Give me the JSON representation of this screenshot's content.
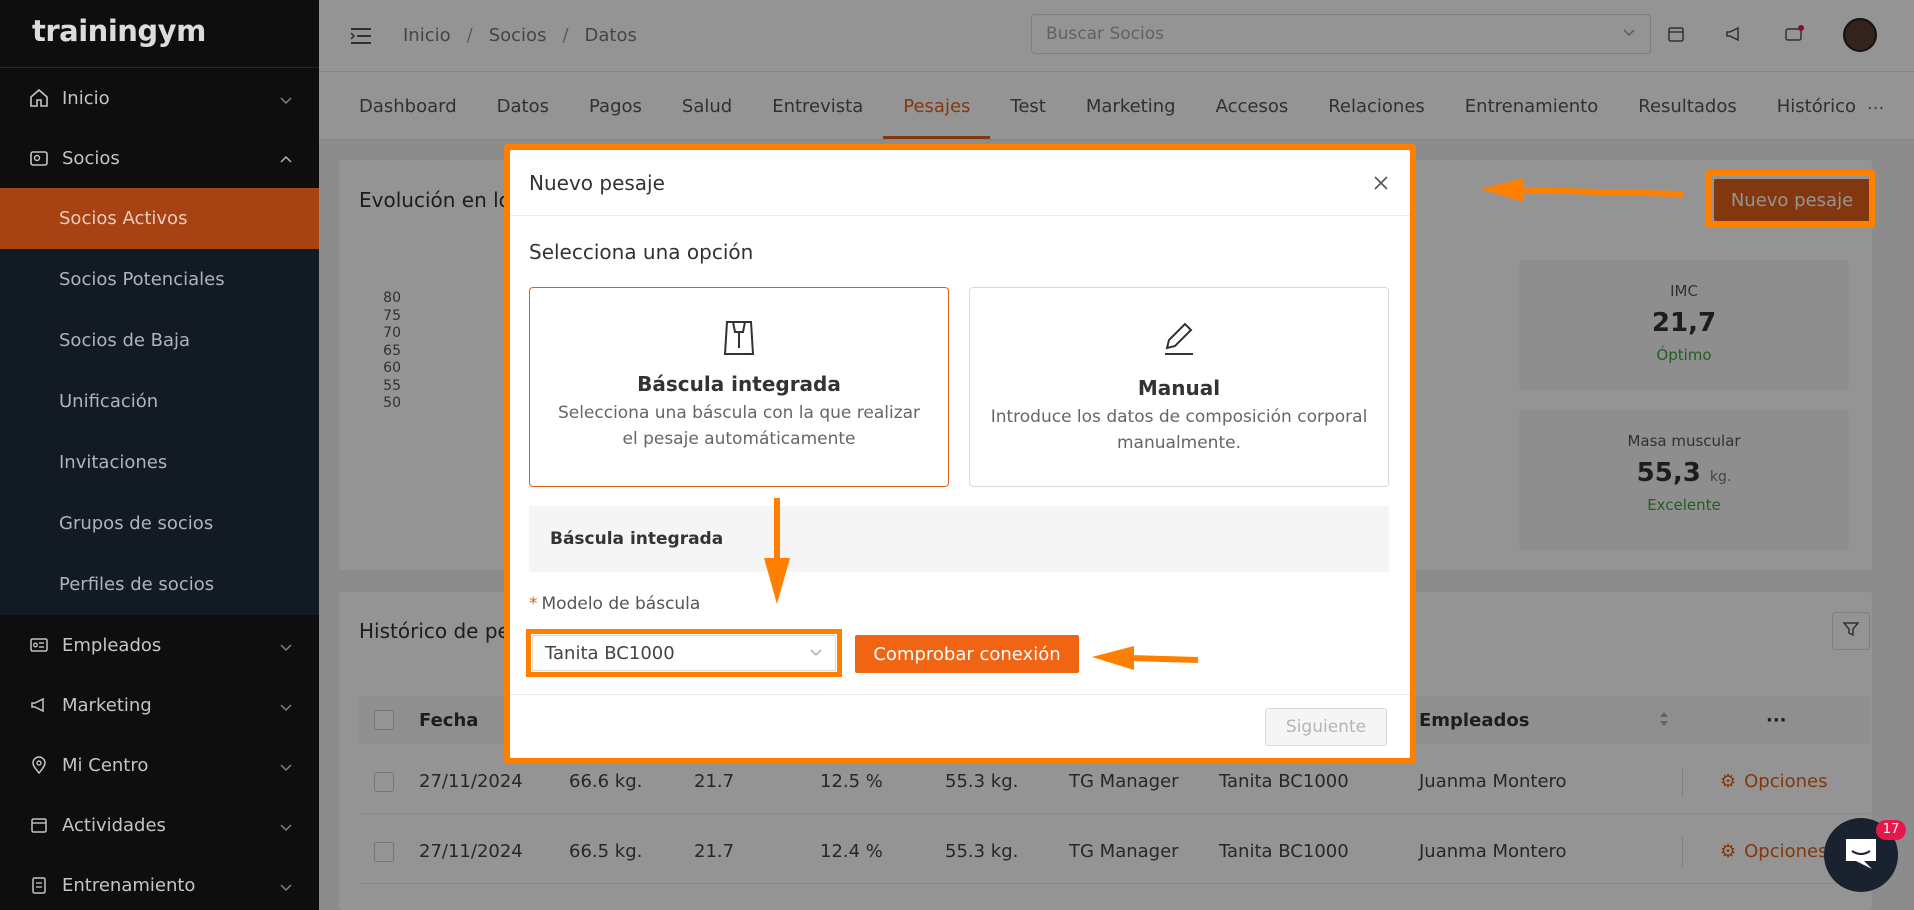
{
  "app": {
    "logo": "trainingym"
  },
  "sidebar": {
    "items": [
      {
        "label": "Inicio",
        "icon": "home-icon"
      },
      {
        "label": "Socios",
        "icon": "members-icon"
      },
      {
        "label": "Empleados",
        "icon": "id-card-icon"
      },
      {
        "label": "Marketing",
        "icon": "megaphone-icon"
      },
      {
        "label": "Mi Centro",
        "icon": "location-icon"
      },
      {
        "label": "Actividades",
        "icon": "calendar-icon"
      },
      {
        "label": "Entrenamiento",
        "icon": "clipboard-icon"
      }
    ],
    "socios_sub": [
      {
        "label": "Socios Activos",
        "active": true
      },
      {
        "label": "Socios Potenciales"
      },
      {
        "label": "Socios de Baja"
      },
      {
        "label": "Unificación"
      },
      {
        "label": "Invitaciones"
      },
      {
        "label": "Grupos de socios"
      },
      {
        "label": "Perfiles de socios"
      }
    ]
  },
  "header": {
    "breadcrumb": [
      "Inicio",
      "Socios",
      "Datos"
    ],
    "search_placeholder": "Buscar Socios"
  },
  "tabs": [
    "Dashboard",
    "Datos",
    "Pagos",
    "Salud",
    "Entrevista",
    "Pesajes",
    "Test",
    "Marketing",
    "Accesos",
    "Relaciones",
    "Entrenamiento",
    "Resultados",
    "Histórico"
  ],
  "tabs_more": "···",
  "active_tab": "Pesajes",
  "evolution": {
    "title": "Evolución en lo",
    "yticks": [
      "80",
      "75",
      "70",
      "65",
      "60",
      "55",
      "50"
    ],
    "new_button": "Nuevo pesaje"
  },
  "stats": [
    {
      "title": "IMC",
      "value": "21,7",
      "unit": "",
      "status": "Óptimo"
    },
    {
      "title": "Masa muscular",
      "value": "55,3",
      "unit": "kg.",
      "status": "Excelente"
    }
  ],
  "history": {
    "title": "Histórico de pe",
    "columns": {
      "fecha": "Fecha",
      "empleados": "Empleados",
      "more": "···"
    },
    "rows": [
      {
        "fecha": "27/11/2024",
        "peso": "66.6 kg.",
        "imc": "21.7",
        "grasa": "12.5 %",
        "musculo": "55.3 kg.",
        "usuario": "TG Manager",
        "bascula": "Tanita BC1000",
        "empleado": "Juanma Montero",
        "opciones": "Opciones"
      },
      {
        "fecha": "27/11/2024",
        "peso": "66.5 kg.",
        "imc": "21.7",
        "grasa": "12.4 %",
        "musculo": "55.3 kg.",
        "usuario": "TG Manager",
        "bascula": "Tanita BC1000",
        "empleado": "Juanma Montero",
        "opciones": "Opciones"
      }
    ]
  },
  "modal": {
    "title": "Nuevo pesaje",
    "subtitle": "Selecciona una opción",
    "options": [
      {
        "title": "Báscula integrada",
        "desc": "Selecciona una báscula con la que realizar el pesaje automáticamente",
        "icon": "scale-icon",
        "selected": true
      },
      {
        "title": "Manual",
        "desc": "Introduce los datos de composición corporal manualmente.",
        "icon": "pencil-icon",
        "selected": false
      }
    ],
    "section": "Báscula integrada",
    "field_label": "Modelo de báscula",
    "field_required": "*",
    "select_value": "Tanita BC1000",
    "check_button": "Comprobar conexión",
    "next_button": "Siguiente"
  },
  "chat": {
    "badge": "17"
  },
  "colors": {
    "accent": "#e2601a",
    "highlight": "#ff8000",
    "sidebar_bg": "#0f0f0f",
    "active_sub": "#b04614"
  }
}
